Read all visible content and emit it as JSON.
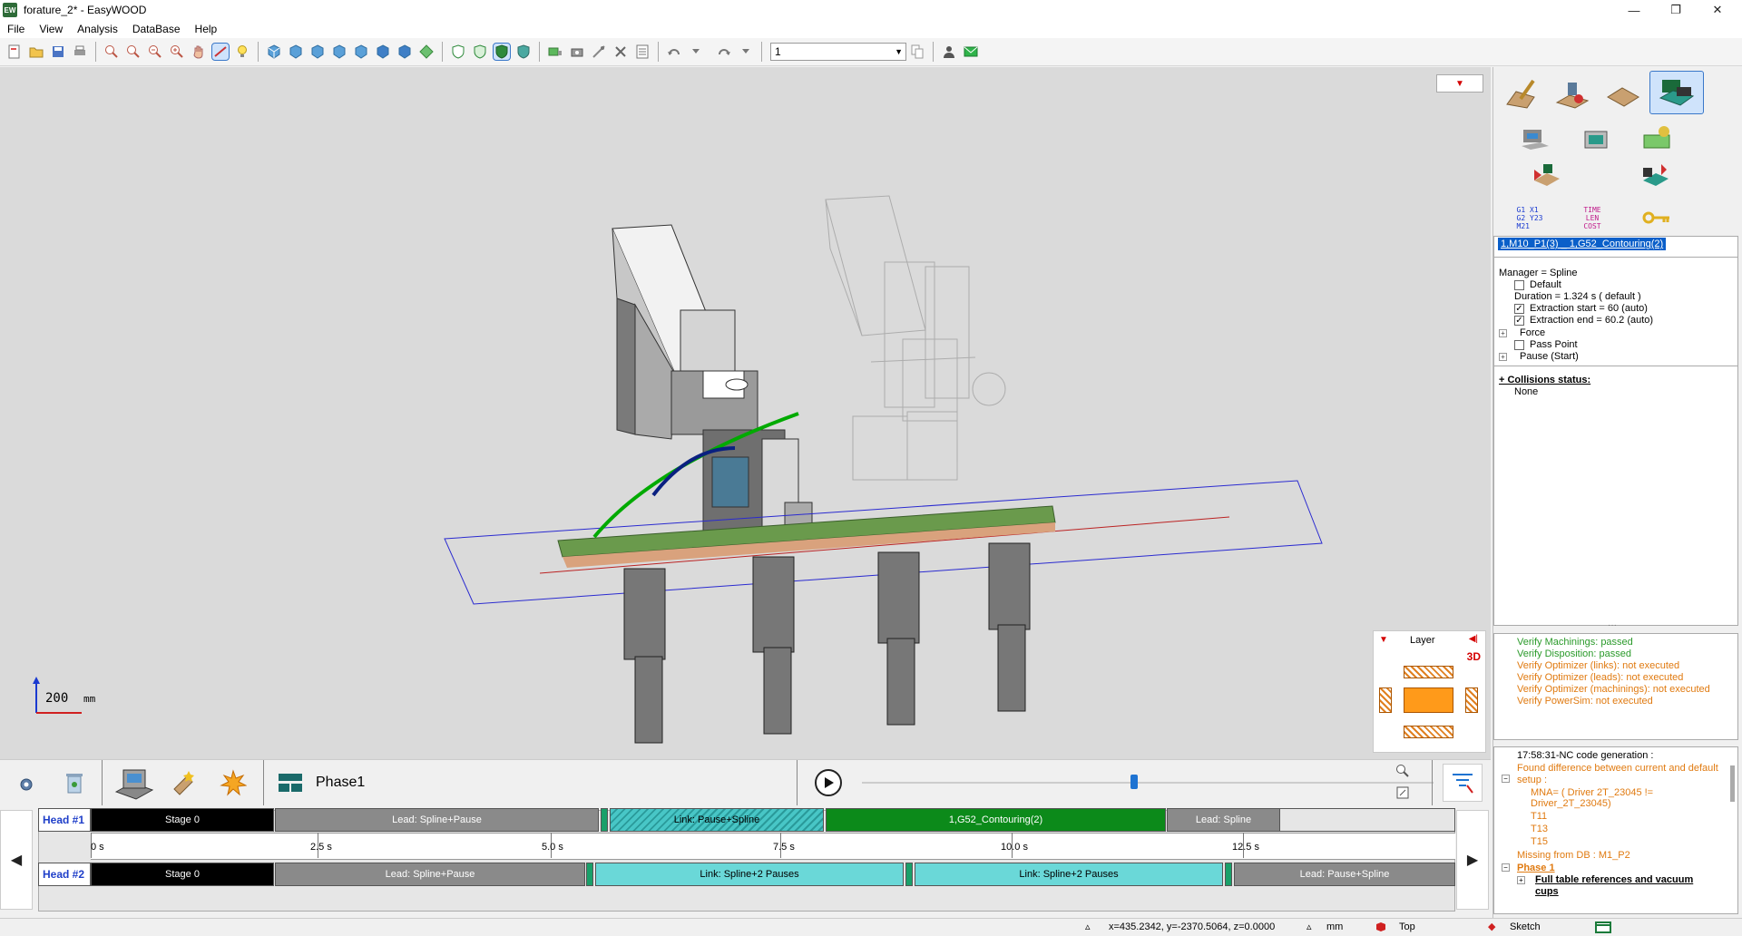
{
  "window": {
    "title": "forature_2* - EasyWOOD",
    "icon_label": "EW",
    "minimize": "—",
    "maximize": "❐",
    "close": "✕"
  },
  "menu": [
    "File",
    "View",
    "Analysis",
    "DataBase",
    "Help"
  ],
  "toolbar": {
    "combo_value": "1"
  },
  "viewport": {
    "scale_label": "200",
    "scale_unit": "mm"
  },
  "layer": {
    "title": "Layer",
    "mode": "3D"
  },
  "properties": {
    "title": "1,M10_P1(3) _ 1,G52_Contouring(2)",
    "manager": "Manager = Spline",
    "default": "Default",
    "duration": "Duration = 1.324 s ( default )",
    "extraction_start": "Extraction start = 60 (auto)",
    "extraction_end": "Extraction end = 60.2 (auto)",
    "force": "Force",
    "pass_point": "Pass Point",
    "pause": "Pause (Start)",
    "collisions_title": "+ Collisions status:",
    "collisions_value": "None"
  },
  "verify": [
    "Verify Machinings: passed",
    "Verify Disposition: passed",
    "Verify Optimizer (links): not executed",
    "Verify Optimizer (leads): not executed",
    "Verify Optimizer (machinings): not executed",
    "Verify PowerSim: not executed"
  ],
  "nc": {
    "header": "17:58:31-NC code generation :",
    "diff1": "Found difference between current and default",
    "diff2": "setup :",
    "mna1": "MNA= ( Driver 2T_23045 !=",
    "mna2": "Driver_2T_23045)",
    "t11": "T11",
    "t13": "T13",
    "t15": "T15",
    "missing": "Missing from DB : M1_P2",
    "phase": "Phase 1",
    "full1": "Full table references and vacuum",
    "full2": "cups"
  },
  "bottom": {
    "phase_label": "Phase1"
  },
  "timeline": {
    "head1": "Head #1",
    "head2": "Head #2",
    "ticks": [
      "0 s",
      "2.5 s",
      "5.0 s",
      "7.5 s",
      "10.0 s",
      "12.5 s"
    ],
    "row1": [
      "Stage 0",
      "Lead: Spline+Pause",
      "Link: Pause+Spline",
      "1,G52_Contouring(2)",
      "Lead: Spline"
    ],
    "row2": [
      "Stage 0",
      "Lead: Spline+Pause",
      "Link: Spline+2 Pauses",
      "Link: Spline+2 Pauses",
      "Lead: Pause+Spline"
    ]
  },
  "status": {
    "coords": "x=435.2342, y=-2370.5064, z=0.0000",
    "unit": "mm",
    "view": "Top",
    "mode": "Sketch"
  },
  "right_icons": {
    "gcode": "G1 X1\nG2 Y23\nM21",
    "time": "TIME\nLEN\nCOST"
  }
}
